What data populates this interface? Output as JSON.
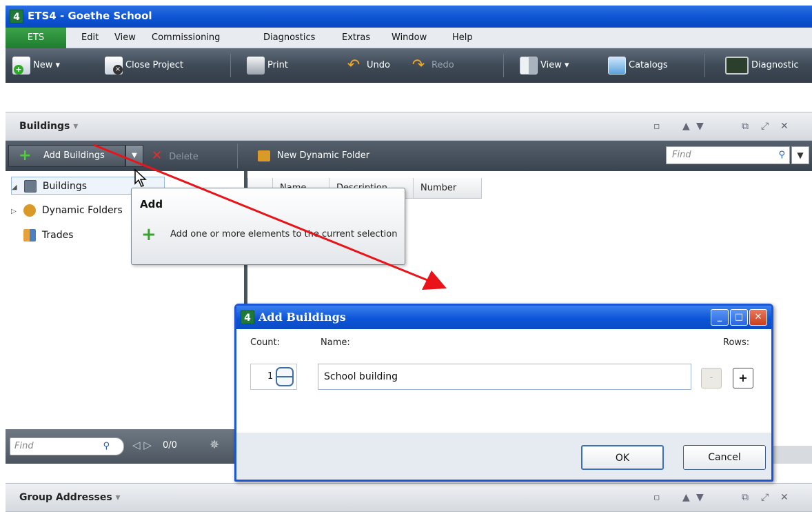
{
  "window": {
    "title": "ETS4 - Goethe School",
    "app_icon": "4"
  },
  "menu": {
    "ets": "ETS",
    "items": [
      "Edit",
      "View",
      "Commissioning",
      "Diagnostics",
      "Extras",
      "Window",
      "Help"
    ]
  },
  "toolbar": {
    "new": "New",
    "close_project": "Close Project",
    "print": "Print",
    "undo": "Undo",
    "redo": "Redo",
    "view": "View",
    "catalogs": "Catalogs",
    "diagnostics": "Diagnostic"
  },
  "buildings_panel": {
    "title": "Buildings",
    "add_buildings": "Add Buildings",
    "delete": "Delete",
    "new_dynamic_folder": "New Dynamic Folder",
    "find_placeholder": "Find",
    "tree": [
      {
        "label": "Buildings",
        "expander": "◢"
      },
      {
        "label": "Dynamic Folders",
        "expander": "▷"
      },
      {
        "label": "Trades",
        "expander": ""
      }
    ],
    "grid_columns": [
      "Name",
      "Description",
      "Number"
    ],
    "tree_find_placeholder": "Find",
    "tree_count": "0/0"
  },
  "tooltip": {
    "title": "Add",
    "body": "Add one or more elements to the current selection"
  },
  "dialog": {
    "title": "Add Buildings",
    "count_label": "Count:",
    "count_value": "1",
    "name_label": "Name:",
    "name_value": "School building",
    "rows_label": "Rows:",
    "rows_minus": "-",
    "rows_plus": "+",
    "ok": "OK",
    "cancel": "Cancel"
  },
  "group_addresses_panel": {
    "title": "Group Addresses"
  },
  "colors": {
    "titlebar_blue": "#0b52d2",
    "ets_green": "#1f7d2e",
    "toolbar_dark": "#3f4a57",
    "annotation_arrow": "#e8141a"
  }
}
